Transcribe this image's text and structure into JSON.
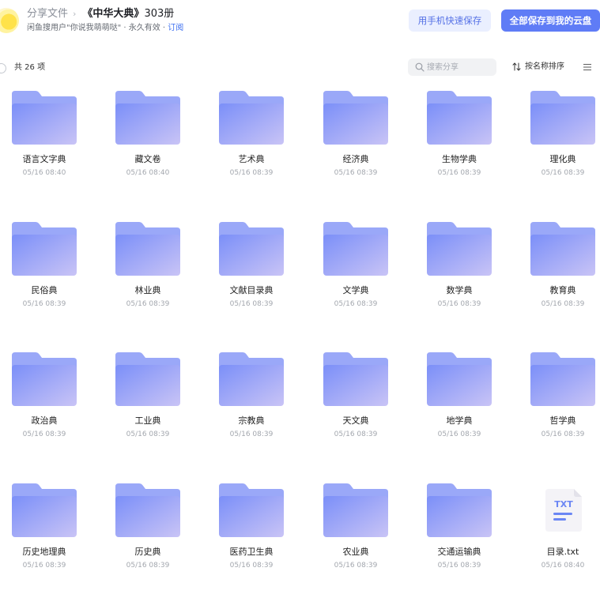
{
  "header": {
    "breadcrumb_root": "分享文件",
    "breadcrumb_sep": "›",
    "title_name": "《中华大典》",
    "title_suffix": "303册",
    "share_meta": "闲鱼搜用户\"你说我萌萌哒\" · 永久有效 ·",
    "subscribe_label": "订阅",
    "quick_save_label": "用手机快速保存",
    "save_all_label": "全部保存到我的云盘"
  },
  "toolbar": {
    "count_label": "共 26 项",
    "search_placeholder": "搜索分享",
    "sort_label": "按名称排序"
  },
  "colors": {
    "accent": "#5f7cf6",
    "accent_light": "#eaefff",
    "folder_front_start": "#7b8ff8",
    "folder_front_end": "#c9c4f6",
    "folder_back": "#9aa8f8"
  },
  "files": [
    {
      "name": "语言文字典",
      "date": "05/16 08:40",
      "type": "folder"
    },
    {
      "name": "藏文卷",
      "date": "05/16 08:40",
      "type": "folder"
    },
    {
      "name": "艺术典",
      "date": "05/16 08:39",
      "type": "folder"
    },
    {
      "name": "经济典",
      "date": "05/16 08:39",
      "type": "folder"
    },
    {
      "name": "生物学典",
      "date": "05/16 08:39",
      "type": "folder"
    },
    {
      "name": "理化典",
      "date": "05/16 08:39",
      "type": "folder"
    },
    {
      "name": "民俗典",
      "date": "05/16 08:39",
      "type": "folder"
    },
    {
      "name": "林业典",
      "date": "05/16 08:39",
      "type": "folder"
    },
    {
      "name": "文献目录典",
      "date": "05/16 08:39",
      "type": "folder"
    },
    {
      "name": "文学典",
      "date": "05/16 08:39",
      "type": "folder"
    },
    {
      "name": "数学典",
      "date": "05/16 08:39",
      "type": "folder"
    },
    {
      "name": "教育典",
      "date": "05/16 08:39",
      "type": "folder"
    },
    {
      "name": "政治典",
      "date": "05/16 08:39",
      "type": "folder"
    },
    {
      "name": "工业典",
      "date": "05/16 08:39",
      "type": "folder"
    },
    {
      "name": "宗教典",
      "date": "05/16 08:39",
      "type": "folder"
    },
    {
      "name": "天文典",
      "date": "05/16 08:39",
      "type": "folder"
    },
    {
      "name": "地学典",
      "date": "05/16 08:39",
      "type": "folder"
    },
    {
      "name": "哲学典",
      "date": "05/16 08:39",
      "type": "folder"
    },
    {
      "name": "历史地理典",
      "date": "05/16 08:39",
      "type": "folder"
    },
    {
      "name": "历史典",
      "date": "05/16 08:39",
      "type": "folder"
    },
    {
      "name": "医药卫生典",
      "date": "05/16 08:39",
      "type": "folder"
    },
    {
      "name": "农业典",
      "date": "05/16 08:39",
      "type": "folder"
    },
    {
      "name": "交通运输典",
      "date": "05/16 08:39",
      "type": "folder"
    },
    {
      "name": "目录.txt",
      "date": "05/16 08:40",
      "type": "txt",
      "icon_text": "TXT"
    }
  ]
}
